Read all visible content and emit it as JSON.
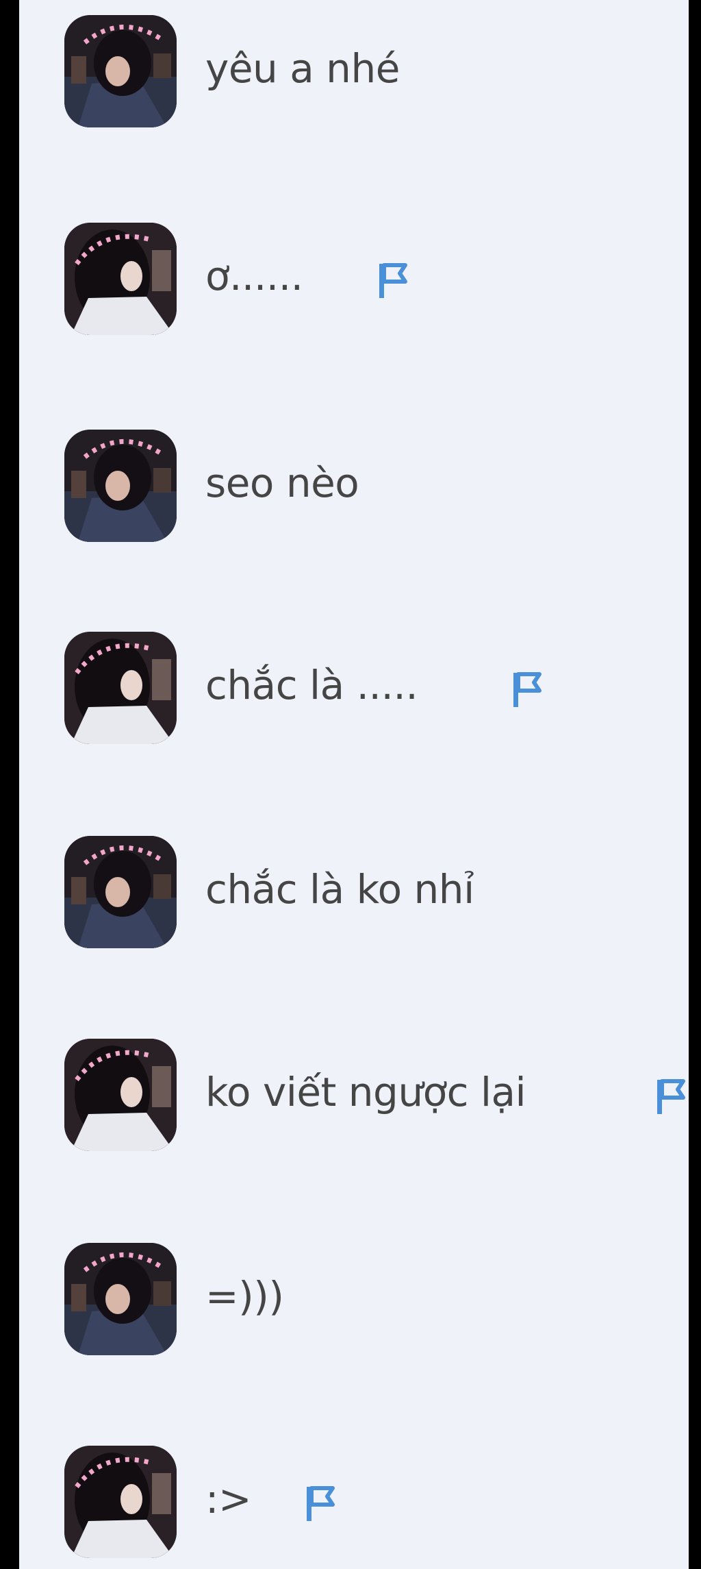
{
  "chat": {
    "messages": [
      {
        "text": "yêu a nhé",
        "avatar": "avatar-variant-a",
        "flag": false
      },
      {
        "text": "ơ......",
        "avatar": "avatar-variant-b",
        "flag": true
      },
      {
        "text": "seo nèo",
        "avatar": "avatar-variant-a",
        "flag": false
      },
      {
        "text": "chắc là .....",
        "avatar": "avatar-variant-b",
        "flag": true
      },
      {
        "text": "chắc là ko nhỉ",
        "avatar": "avatar-variant-a",
        "flag": false
      },
      {
        "text": "ko viết ngược lại",
        "avatar": "avatar-variant-b",
        "flag": true
      },
      {
        "text": "=)))",
        "avatar": "avatar-variant-a",
        "flag": false
      },
      {
        "text": ":>",
        "avatar": "avatar-variant-b",
        "flag": true
      }
    ]
  },
  "icons": {
    "flag": "flag-icon"
  },
  "colors": {
    "panel_background": "#eff2f8",
    "frame": "#000000",
    "message_text": "#454545",
    "flag_blue": "#4a90d9"
  }
}
